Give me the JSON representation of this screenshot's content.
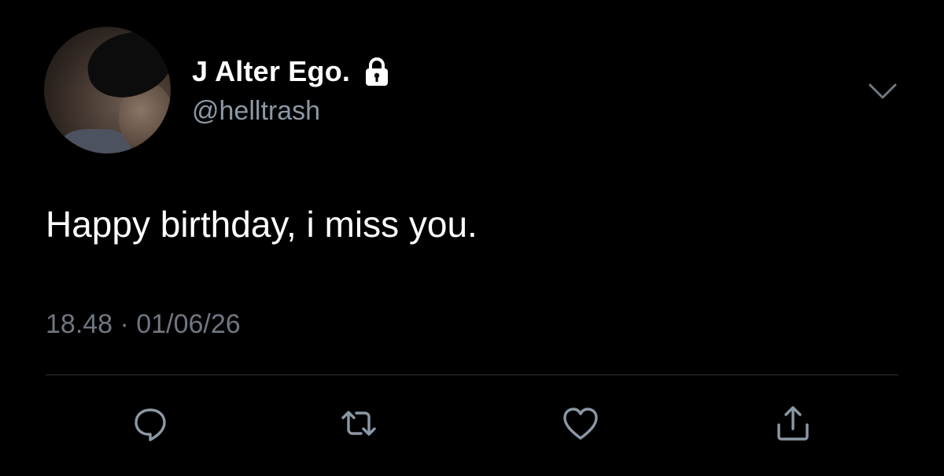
{
  "tweet": {
    "author": {
      "display_name": "J Alter Ego.",
      "handle": "@helltrash",
      "protected_icon": "lock-icon"
    },
    "text": "Happy birthday, i miss you.",
    "timestamp": "18.48 · 01/06/26",
    "menu_icon": "chevron-down-icon"
  },
  "actions": [
    {
      "name": "reply",
      "icon": "speech-bubble-icon"
    },
    {
      "name": "retweet",
      "icon": "retweet-icon"
    },
    {
      "name": "like",
      "icon": "heart-icon"
    },
    {
      "name": "share",
      "icon": "share-icon"
    }
  ],
  "colors": {
    "background": "#000000",
    "primary_text": "#ffffff",
    "secondary_text": "#8b98a5",
    "timestamp_text": "#6e7780",
    "icon": "#8b98a5",
    "divider": "#2f3336"
  }
}
